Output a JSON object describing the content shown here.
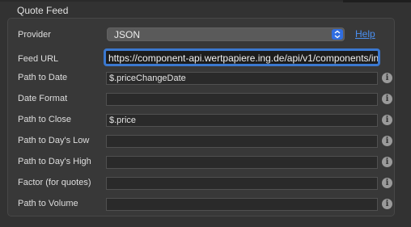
{
  "group": {
    "title": "Quote Feed"
  },
  "provider": {
    "label": "Provider",
    "value": "JSON",
    "help": "Help"
  },
  "feed_url": {
    "label": "Feed URL",
    "value": "https://component-api.wertpapiere.ing.de/api/v1/components/in"
  },
  "fields": [
    {
      "label": "Path to Date",
      "value": "$.priceChangeDate"
    },
    {
      "label": "Date Format",
      "value": ""
    },
    {
      "label": "Path to Close",
      "value": "$.price"
    },
    {
      "label": "Path to Day's Low",
      "value": ""
    },
    {
      "label": "Path to Day's High",
      "value": ""
    },
    {
      "label": "Factor (for quotes)",
      "value": ""
    },
    {
      "label": "Path to Volume",
      "value": ""
    }
  ],
  "icons": {
    "info": "info-icon",
    "select_arrows": "updown-chevron-icon"
  },
  "colors": {
    "accent": "#2f6de1",
    "link": "#4a8ff0",
    "focus_ring": "#3b78cf"
  }
}
